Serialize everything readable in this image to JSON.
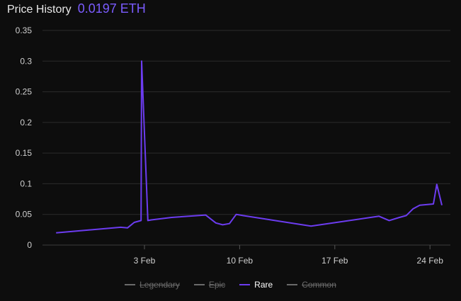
{
  "header": {
    "title": "Price History",
    "price": "0.0197 ETH"
  },
  "colors": {
    "accent": "#6c3cf0",
    "grid": "#2b2b2b",
    "inactive": "#6a6a6a"
  },
  "chart_data": {
    "type": "line",
    "title": "",
    "xlabel": "",
    "ylabel": "",
    "ylim": [
      0,
      0.35
    ],
    "yticks": [
      "0",
      "0.05",
      "0.1",
      "0.15",
      "0.2",
      "0.25",
      "0.3",
      "0.35"
    ],
    "xticks": [
      "3 Feb",
      "10 Feb",
      "17 Feb",
      "24 Feb"
    ],
    "grid": true,
    "legend_position": "bottom",
    "legend": [
      {
        "name": "Legendary",
        "visible": false
      },
      {
        "name": "Epic",
        "visible": false
      },
      {
        "name": "Rare",
        "visible": true
      },
      {
        "name": "Common",
        "visible": false
      }
    ],
    "series": [
      {
        "name": "Rare",
        "color": "#6c3cf0",
        "x": [
          "2024-01-27 12:00",
          "2024-02-01 06:00",
          "2024-02-01 18:00",
          "2024-02-02 06:00",
          "2024-02-02 18:00",
          "2024-02-02 19:00",
          "2024-02-03 06:00",
          "2024-02-03 12:00",
          "2024-02-05 00:00",
          "2024-02-07 12:00",
          "2024-02-08 06:00",
          "2024-02-08 18:00",
          "2024-02-09 06:00",
          "2024-02-09 18:00",
          "2024-02-10 06:00",
          "2024-02-15 06:00",
          "2024-02-20 06:00",
          "2024-02-21 00:00",
          "2024-02-21 18:00",
          "2024-02-22 06:00",
          "2024-02-22 18:00",
          "2024-02-23 06:00",
          "2024-02-23 18:00",
          "2024-02-24 06:00",
          "2024-02-24 12:00",
          "2024-02-24 21:00"
        ],
        "y": [
          0.02,
          0.029,
          0.028,
          0.037,
          0.04,
          0.3,
          0.04,
          0.041,
          0.045,
          0.049,
          0.036,
          0.033,
          0.035,
          0.05,
          0.048,
          0.031,
          0.047,
          0.04,
          0.045,
          0.048,
          0.059,
          0.065,
          0.066,
          0.067,
          0.099,
          0.065
        ]
      }
    ]
  }
}
